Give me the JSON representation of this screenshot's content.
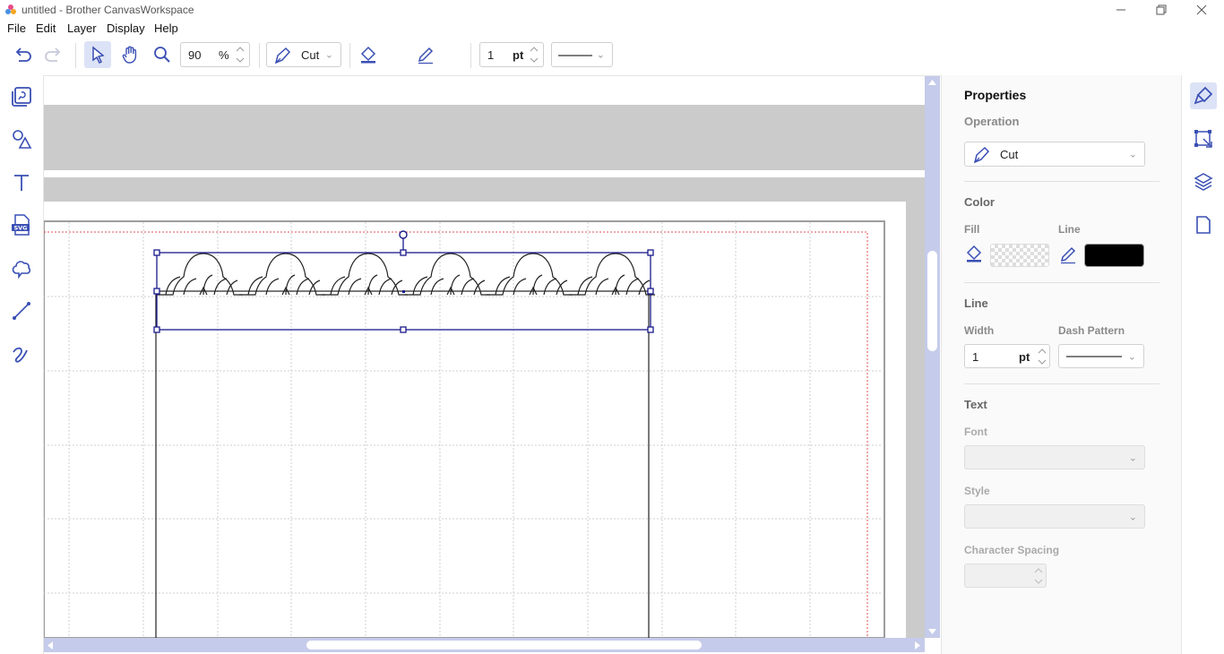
{
  "window": {
    "title": "untitled - Brother CanvasWorkspace"
  },
  "menu": [
    "File",
    "Edit",
    "Layer",
    "Display",
    "Help"
  ],
  "toolbar": {
    "zoom_value": "90",
    "zoom_unit": "%",
    "operation": "Cut",
    "line_width": "1",
    "line_unit": "pt",
    "fill_color": "transparent",
    "line_color": "#000000"
  },
  "properties": {
    "title": "Properties",
    "operation_label": "Operation",
    "operation_value": "Cut",
    "color_label": "Color",
    "fill_label": "Fill",
    "line_label": "Line",
    "line_section": "Line",
    "width_label": "Width",
    "width_value": "1",
    "width_unit": "pt",
    "dash_label": "Dash Pattern",
    "text_section": "Text",
    "font_label": "Font",
    "style_label": "Style",
    "spacing_label": "Character Spacing"
  },
  "colors": {
    "accent": "#3a4fb4",
    "scroll": "#c5cbea",
    "selection": "#1a1a8c",
    "margin": "#e05050"
  }
}
